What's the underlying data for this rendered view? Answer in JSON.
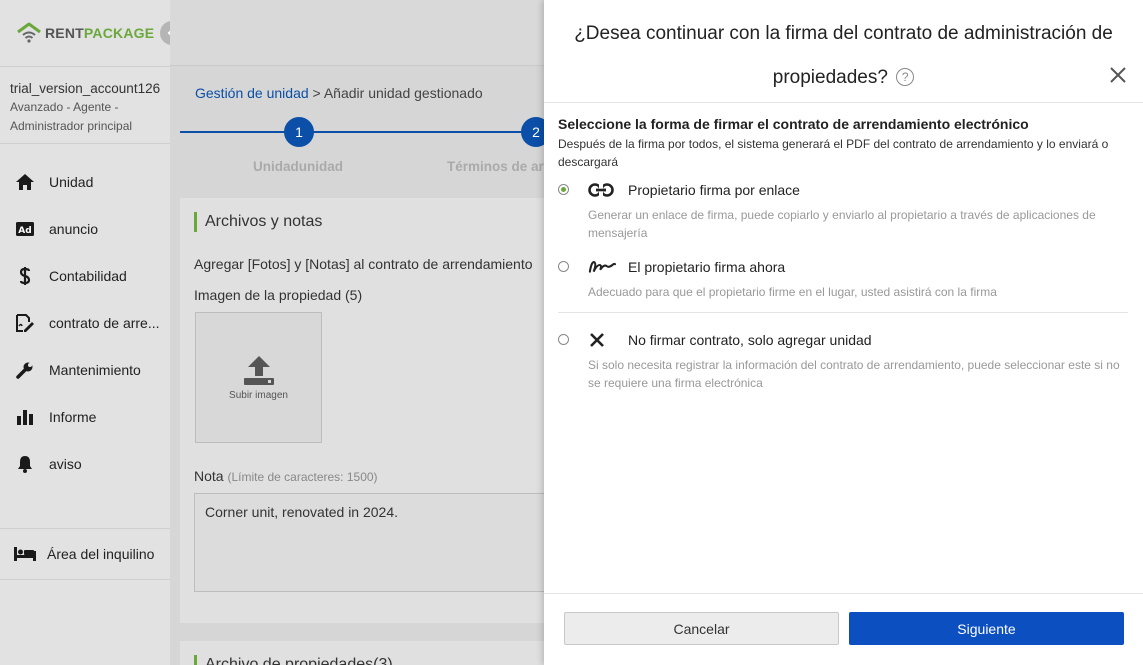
{
  "brand": {
    "part1": "RENT",
    "part2": "PACKAGE"
  },
  "account": {
    "name": "trial_version_account126",
    "role": "Avanzado - Agente - Administrador principal"
  },
  "sidebar": {
    "items": [
      {
        "label": "Unidad",
        "icon": "home-icon"
      },
      {
        "label": "anuncio",
        "icon": "ad-icon"
      },
      {
        "label": "Contabilidad",
        "icon": "dollar-icon"
      },
      {
        "label": "contrato de arre...",
        "icon": "contract-sign-icon"
      },
      {
        "label": "Mantenimiento",
        "icon": "wrench-icon"
      },
      {
        "label": "Informe",
        "icon": "bar-chart-icon"
      },
      {
        "label": "aviso",
        "icon": "bell-icon"
      }
    ],
    "tenant_area": "Área del inquilino"
  },
  "breadcrumb": {
    "parent": "Gestión de unidad",
    "separator": ">",
    "current": "Añadir unidad gestionado"
  },
  "steps": [
    {
      "number": "1",
      "label": "Unidadunidad"
    },
    {
      "number": "2",
      "label": "Términos de ar"
    }
  ],
  "card": {
    "title": "Archivos y notas",
    "description": "Agregar [Fotos] y [Notas] al contrato de arrendamiento",
    "image_section": "Imagen de la propiedad (5)",
    "upload_label": "Subir imagen",
    "note_label": "Nota",
    "note_hint": "(Límite de caracteres: 1500)",
    "note_value": "Corner unit, renovated in 2024."
  },
  "card2": {
    "title": "Archivo de propiedades(3)"
  },
  "modal": {
    "title": "¿Desea continuar con la firma del contrato de administración de propiedades?",
    "help": "?",
    "section_title": "Seleccione la forma de firmar el contrato de arrendamiento electrónico",
    "section_desc": "Después de la firma por todos, el sistema generará el PDF del contrato de arrendamiento y lo enviará o descargará",
    "options": [
      {
        "label": "Propietario firma por enlace",
        "desc": "Generar un enlace de firma, puede copiarlo y enviarlo al propietario a través de aplicaciones de mensajería",
        "selected": true,
        "icon": "link-icon"
      },
      {
        "label": "El propietario firma ahora",
        "desc": "Adecuado para que el propietario firme en el lugar, usted asistirá con la firma",
        "selected": false,
        "icon": "signature-icon"
      },
      {
        "label": "No firmar contrato, solo agregar unidad",
        "desc": "Si solo necesita registrar la información del contrato de arrendamiento, puede seleccionar este si no se requiere una firma electrónica",
        "selected": false,
        "icon": "x-icon"
      }
    ],
    "cancel_label": "Cancelar",
    "next_label": "Siguiente"
  },
  "colors": {
    "primary": "#0b4fc1",
    "brand_green": "#6aa83b",
    "link_blue": "#0b4fa8"
  }
}
